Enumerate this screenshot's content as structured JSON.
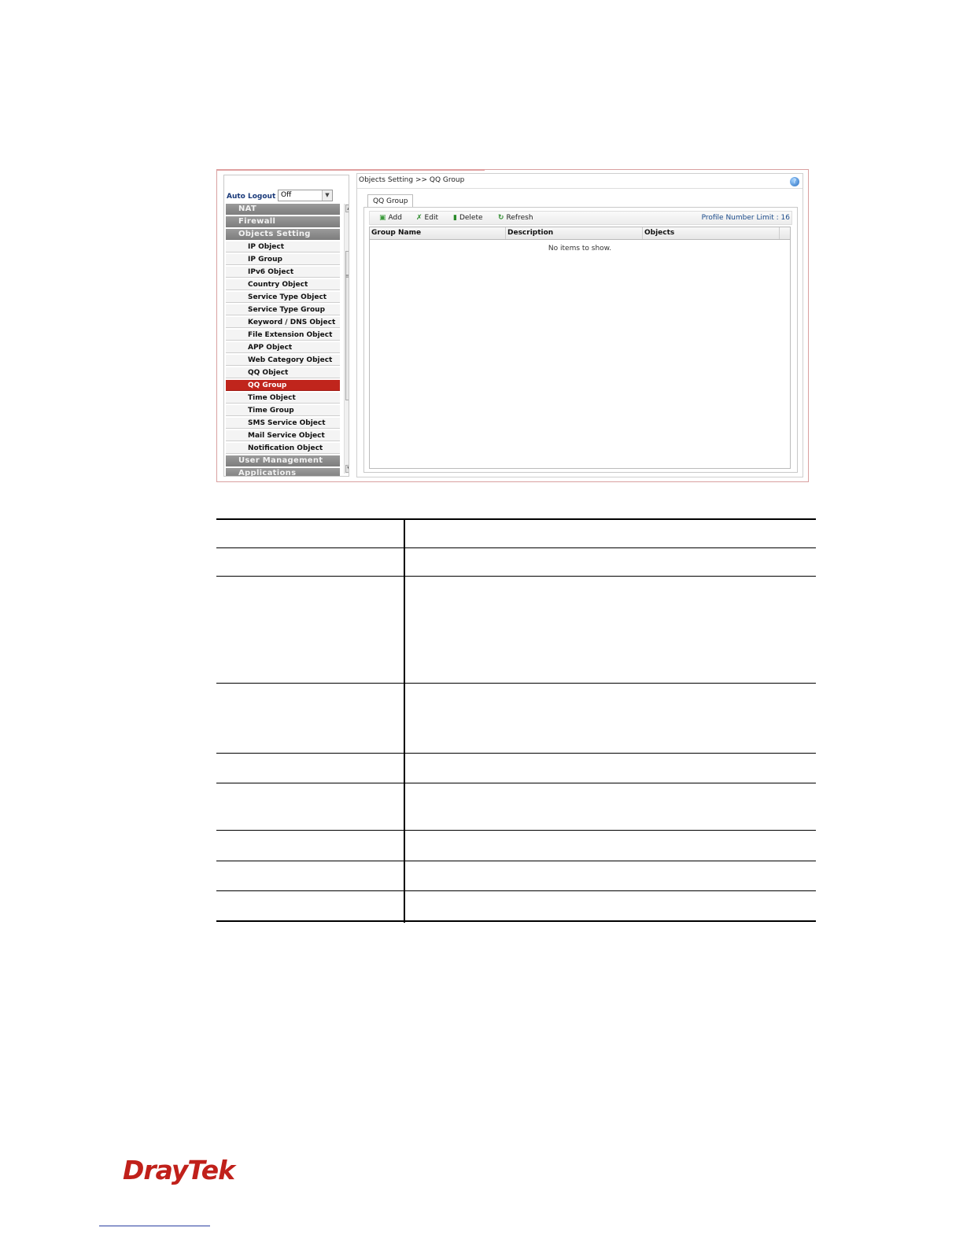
{
  "sidebar": {
    "auto_logout_label": "Auto Logout :",
    "auto_logout_value": "Off",
    "categories": {
      "nat": "NAT",
      "firewall": "Firewall",
      "objects_setting": "Objects Setting",
      "user_management": "User Management",
      "applications": "Applications"
    },
    "items": [
      {
        "label": "IP Object"
      },
      {
        "label": "IP Group"
      },
      {
        "label": "IPv6 Object"
      },
      {
        "label": "Country Object"
      },
      {
        "label": "Service Type Object"
      },
      {
        "label": "Service Type Group"
      },
      {
        "label": "Keyword / DNS Object"
      },
      {
        "label": "File Extension Object"
      },
      {
        "label": "APP Object"
      },
      {
        "label": "Web Category Object"
      },
      {
        "label": "QQ Object"
      },
      {
        "label": "QQ Group",
        "active": true
      },
      {
        "label": "Time Object"
      },
      {
        "label": "Time Group"
      },
      {
        "label": "SMS Service Object"
      },
      {
        "label": "Mail Service Object"
      },
      {
        "label": "Notification Object"
      }
    ]
  },
  "main": {
    "breadcrumb": "Objects Setting >> QQ Group",
    "tab": "QQ Group",
    "toolbar": {
      "add": "Add",
      "edit": "Edit",
      "delete": "Delete",
      "refresh": "Refresh",
      "profile_limit": "Profile Number Limit : 16"
    },
    "columns": [
      "Group Name",
      "Description",
      "Objects"
    ],
    "empty_message": "No items to show."
  },
  "footer": {
    "logo": "DrayTek"
  },
  "colors": {
    "accent_red": "#c0251c",
    "menu_gray": "#8a8a8a",
    "link_blue": "#1a4a8a"
  }
}
